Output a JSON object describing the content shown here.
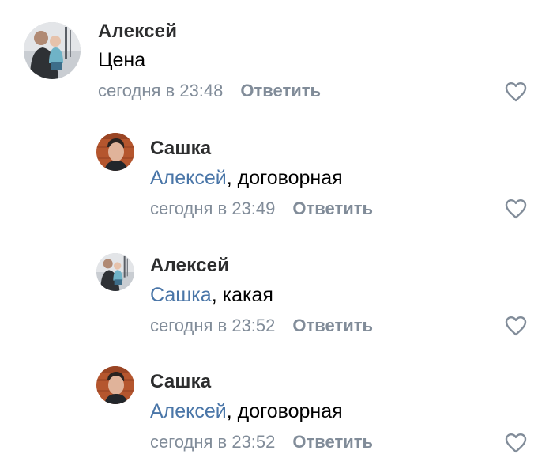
{
  "comments": [
    {
      "author": "Алексей",
      "mention": "",
      "text": "Цена",
      "time": "сегодня в 23:48",
      "reply_label": "Ответить",
      "avatar_icon": "man-with-child-photo"
    },
    {
      "author": "Сашка",
      "mention": "Алексей",
      "text": ", договорная",
      "time": "сегодня в 23:49",
      "reply_label": "Ответить",
      "avatar_icon": "man-portrait-photo"
    },
    {
      "author": "Алексей",
      "mention": "Сашка",
      "text": ", какая",
      "time": "сегодня в 23:52",
      "reply_label": "Ответить",
      "avatar_icon": "man-with-child-photo"
    },
    {
      "author": "Сашка",
      "mention": "Алексей",
      "text": ", договорная",
      "time": "сегодня в 23:52",
      "reply_label": "Ответить",
      "avatar_icon": "man-portrait-photo"
    }
  ],
  "colors": {
    "mention": "#4a76a8",
    "meta": "#818c99",
    "author": "#2c2d2e",
    "like_icon": "#818c99"
  }
}
